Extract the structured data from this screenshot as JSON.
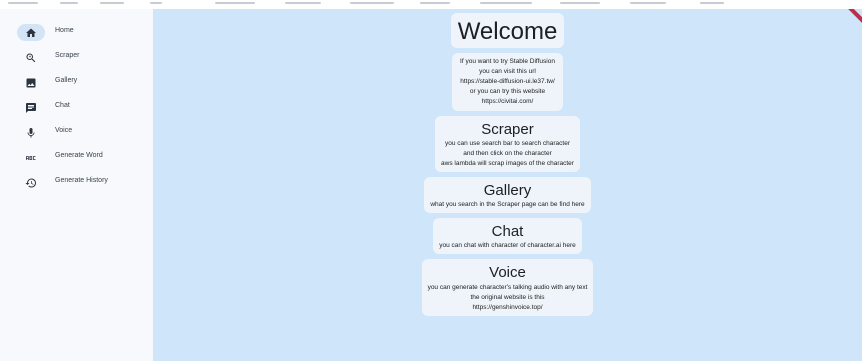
{
  "sidebar": {
    "items": [
      {
        "label": "Home",
        "icon": "home-icon",
        "active": true
      },
      {
        "label": "Scraper",
        "icon": "search-icon",
        "active": false
      },
      {
        "label": "Gallery",
        "icon": "image-icon",
        "active": false
      },
      {
        "label": "Chat",
        "icon": "chat-icon",
        "active": false
      },
      {
        "label": "Voice",
        "icon": "microphone-icon",
        "active": false
      },
      {
        "label": "Generate Word",
        "icon": "abc-icon",
        "active": false
      },
      {
        "label": "Generate History",
        "icon": "history-icon",
        "active": false
      }
    ]
  },
  "main": {
    "welcome_title": "Welcome",
    "info_lines": [
      "If you want to try Stable Diffusion",
      "you can visit this url",
      "https://stable-diffusion-ui.le37.tw/",
      "or you can try this website",
      "https://civitai.com/"
    ],
    "sections": [
      {
        "title": "Scraper",
        "lines": [
          "you can use search bar to search character",
          "and then click on the character",
          "aws lambda will scrap images of the character"
        ]
      },
      {
        "title": "Gallery",
        "lines": [
          "what you search in the Scraper page can be find here"
        ]
      },
      {
        "title": "Chat",
        "lines": [
          "you can chat with character of character.ai here"
        ]
      },
      {
        "title": "Voice",
        "lines": [
          "you can generate character's talking audio with any text",
          "the original website is this",
          "https://genshinvoice.top/"
        ]
      }
    ]
  },
  "colors": {
    "background": "#cfe5f9",
    "sidebar": "#f7f9fc",
    "card": "#eef4f9",
    "active_indicator": "#d3e4f7",
    "debug_banner": "#b7304e"
  }
}
